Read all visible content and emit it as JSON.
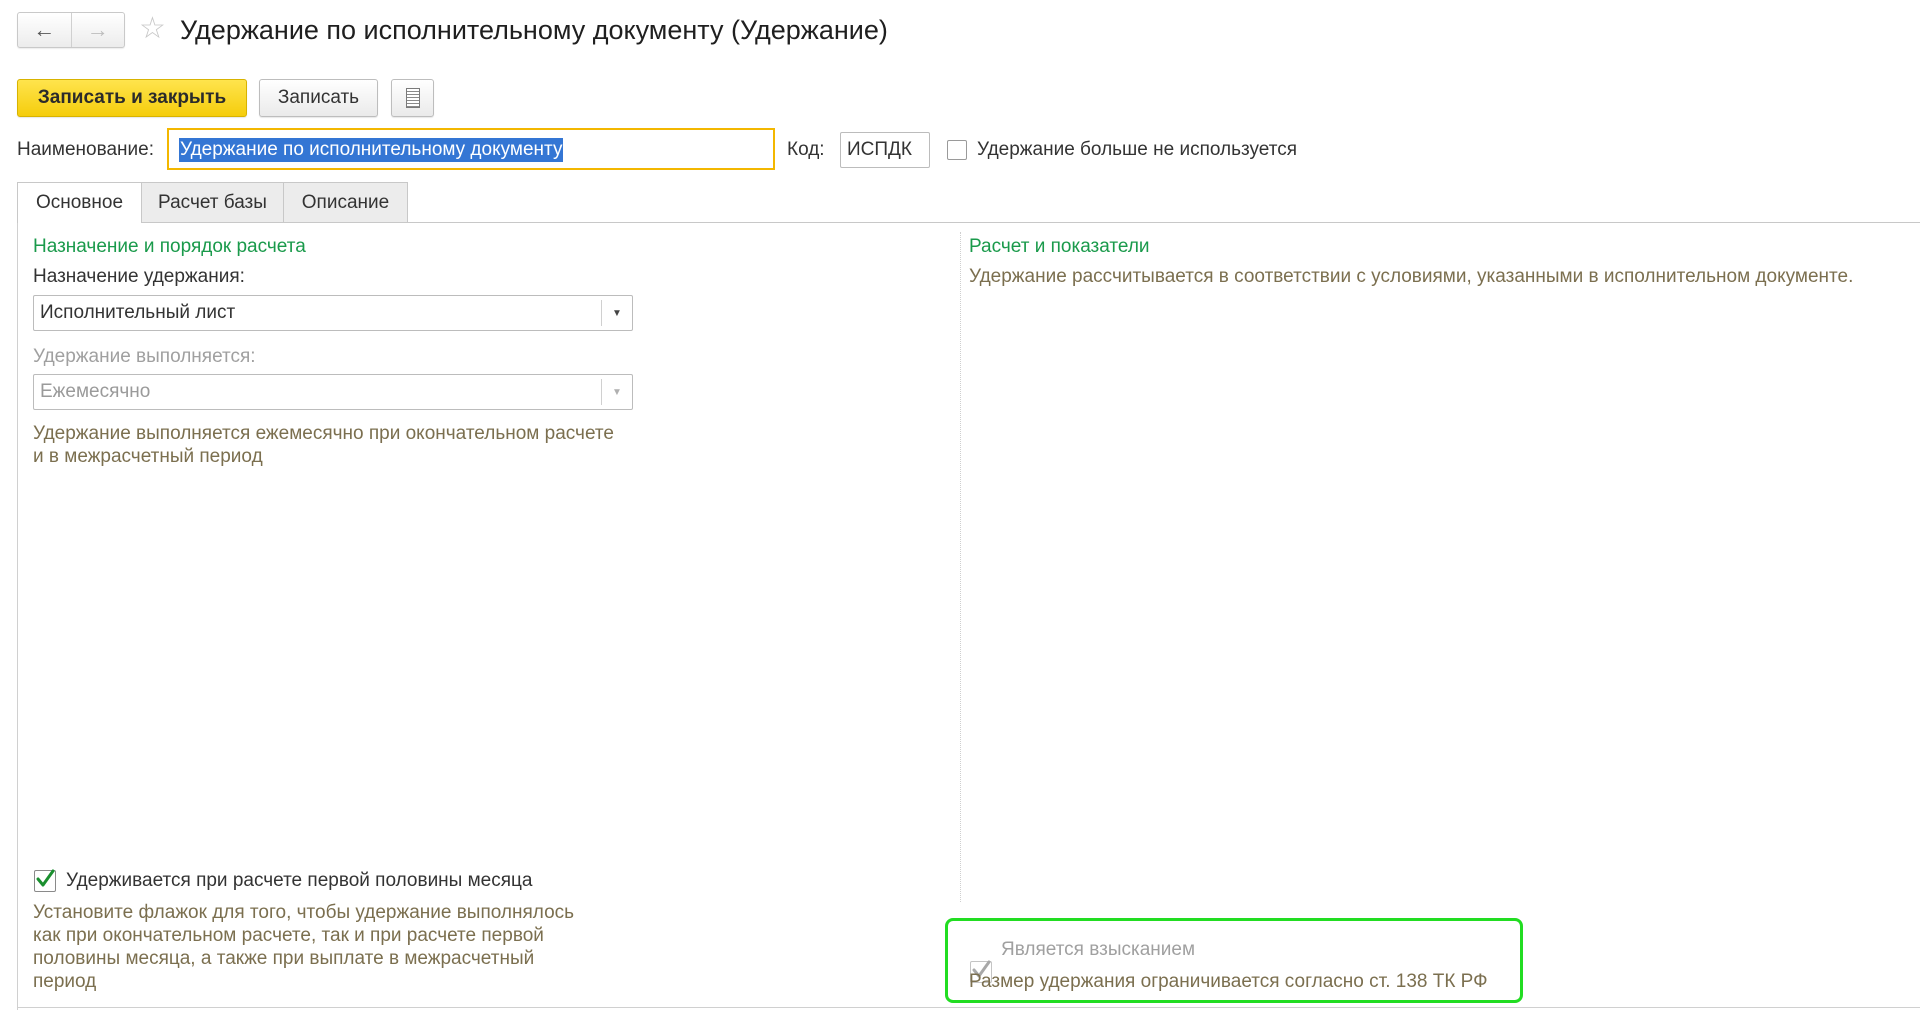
{
  "window": {
    "title": "Удержание по исполнительному документу (Удержание)",
    "back_icon": "←",
    "forward_icon": "→",
    "favorite_icon": "☆"
  },
  "toolbar": {
    "save_close_label": "Записать и закрыть",
    "save_label": "Записать"
  },
  "form": {
    "name_label": "Наименование:",
    "name_value": "Удержание по исполнительному документу",
    "code_label": "Код:",
    "code_value": "ИСПДК",
    "unused_checkbox_label": "Удержание больше не используется",
    "unused_checked": false
  },
  "tabs": [
    {
      "label": "Основное",
      "active": true
    },
    {
      "label": "Расчет базы",
      "active": false
    },
    {
      "label": "Описание",
      "active": false
    }
  ],
  "left": {
    "section_title": "Назначение и порядок расчета",
    "purpose_label": "Назначение удержания:",
    "purpose_value": "Исполнительный лист",
    "performed_label": "Удержание выполняется:",
    "performed_value": "Ежемесячно",
    "performed_hint_1": "Удержание выполняется ежемесячно при окончательном расчете",
    "performed_hint_2": "и в межрасчетный период",
    "first_half_label": "Удерживается при расчете первой половины месяца",
    "first_half_checked": true,
    "first_half_hint": [
      "Установите флажок для того, чтобы удержание выполнялось",
      "как при окончательном расчете, так и при расчете первой",
      "половины месяца, а также при выплате в межрасчетный",
      "период"
    ]
  },
  "right": {
    "section_title": "Расчет и показатели",
    "description": "Удержание рассчитывается в соответствии с условиями, указанными в исполнительном документе.",
    "collection_label": "Является взысканием",
    "collection_checked": true,
    "collection_hint": "Размер удержания ограничивается согласно ст. 138 ТК РФ"
  },
  "colors": {
    "primary_button": "#f5cd0c",
    "section_title": "#1a9a4b",
    "hint_text": "#7b6f4f",
    "highlight_frame": "#22dd22",
    "focus_border": "#f3b700",
    "selection": "#3476d4"
  }
}
